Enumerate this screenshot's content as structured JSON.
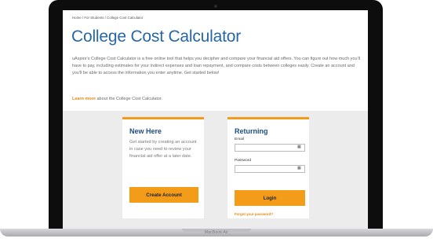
{
  "page": {
    "breadcrumb": "Home / For Students / College Cost Calculator",
    "title": "College Cost Calculator",
    "intro": "uAspire's College Cost Calculator is a free online tool that helps you decipher and compare your financial aid offers. You can figure out how much you'll have to pay, including estimates for your indirect expenses and loan repayment, and compare costs between colleges easily. Create an account and you'll be able to access the information you enter anytime. Get started below!",
    "learn_more_link": "Learn more",
    "learn_more_rest": " about the College Cost Calculator."
  },
  "new_here": {
    "title": "New Here",
    "text": "Get started by creating an account in case you need to review your financial aid offer at a later date.",
    "button": "Create Account"
  },
  "returning": {
    "title": "Returning",
    "email_label": "Email",
    "email_value": "",
    "password_label": "Password",
    "password_value": "",
    "button": "Login",
    "forgot": "Forgot your password?"
  },
  "device": {
    "brand": "MacBook Air"
  },
  "colors": {
    "accent": "#f39c1a",
    "title_blue": "#2866a6",
    "card_title": "#214f82",
    "link_orange": "#e68a12"
  },
  "icons": {
    "field_icon": "key-icon"
  }
}
